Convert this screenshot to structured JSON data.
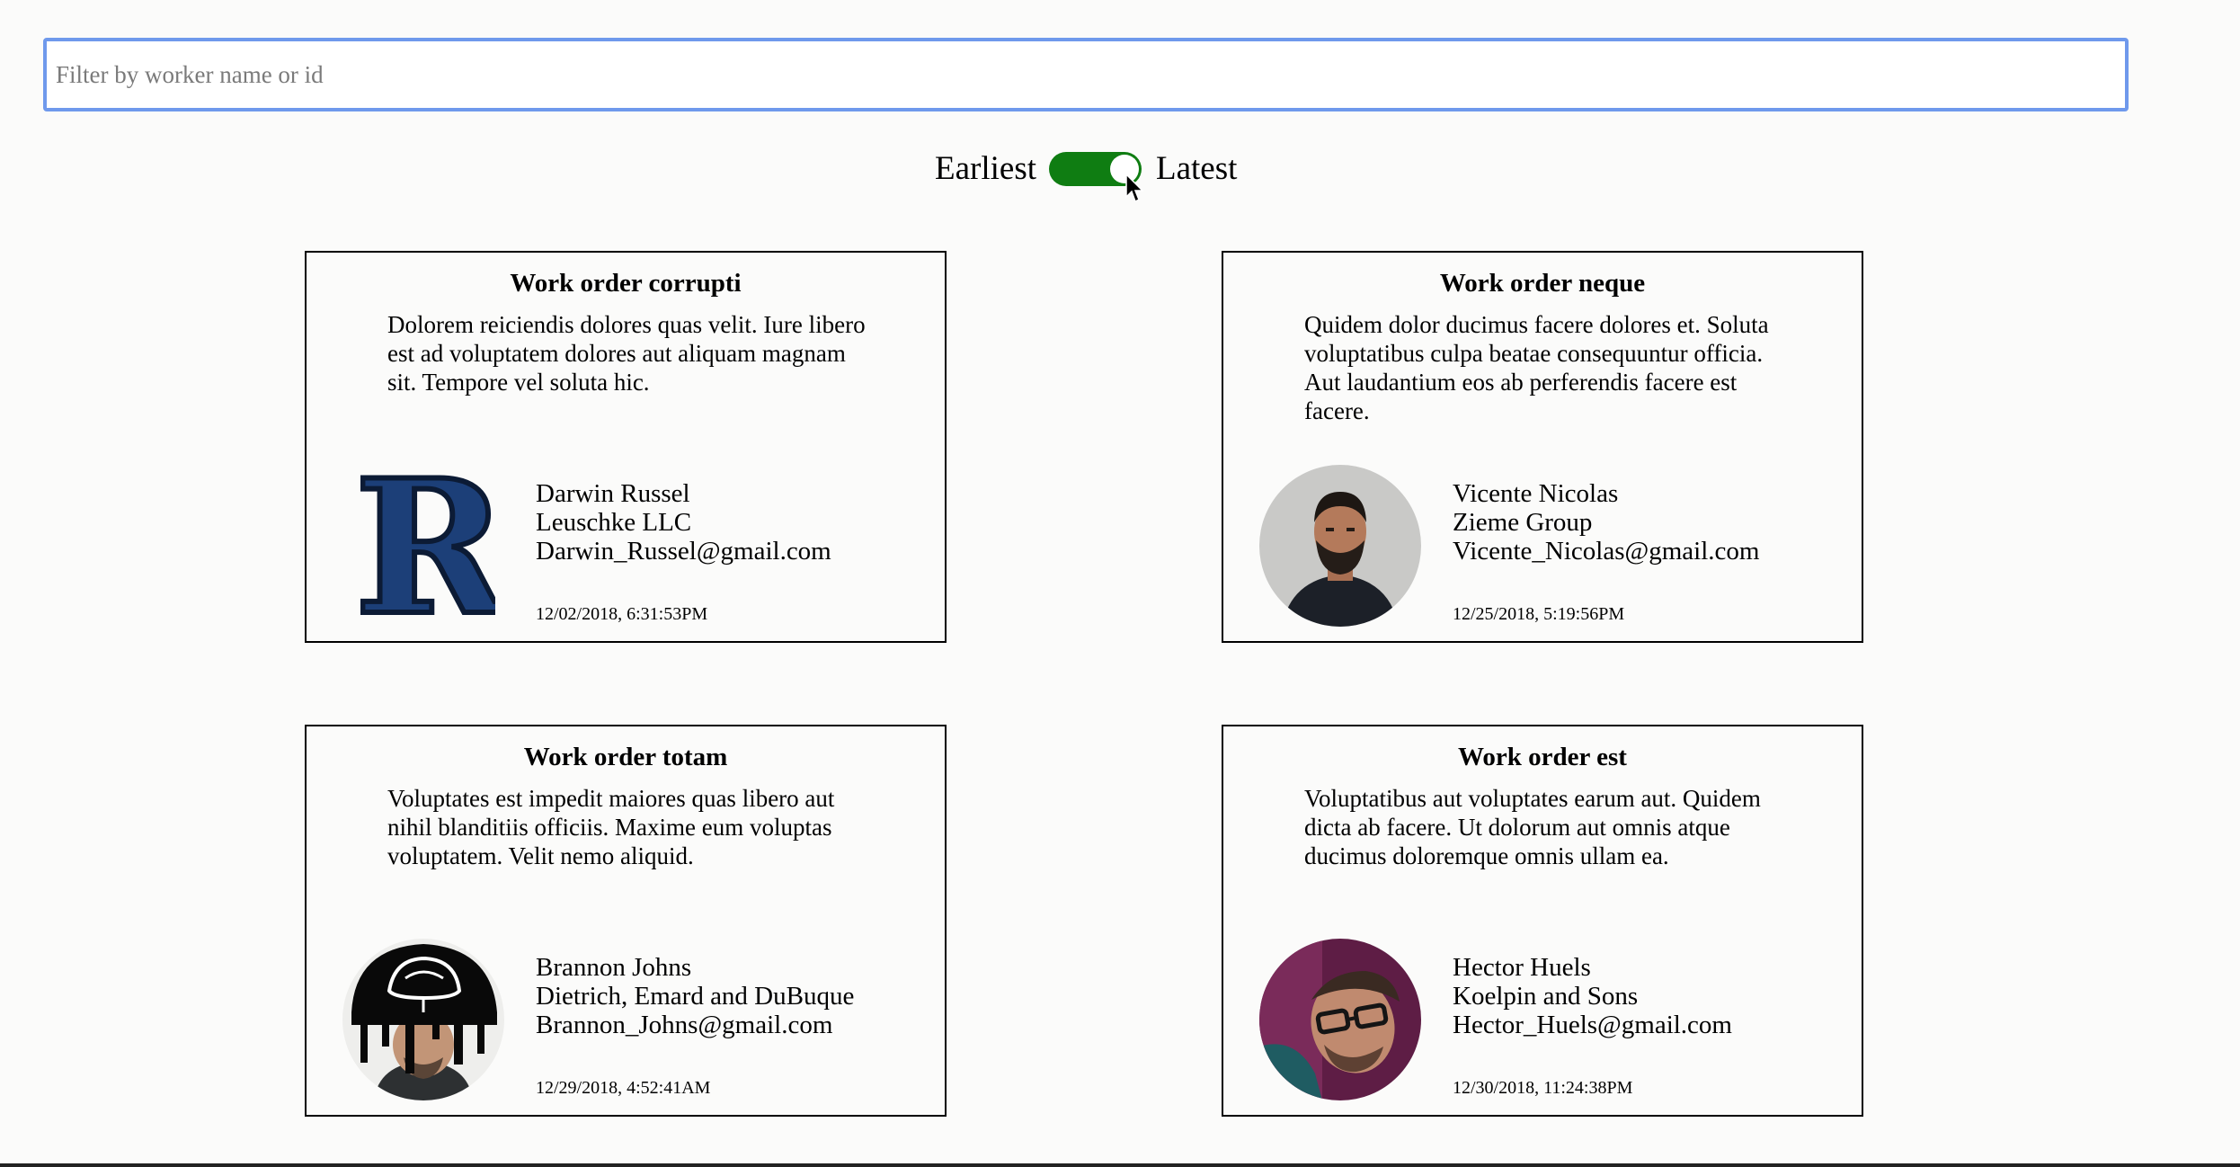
{
  "filter": {
    "placeholder": "Filter by worker name or id"
  },
  "sort_toggle": {
    "left_label": "Earliest",
    "right_label": "Latest",
    "state": "latest",
    "on_color": "#0f7d12"
  },
  "cards": [
    {
      "title": "Work order corrupti",
      "description": "Dolorem reiciendis dolores quas velit. Iure libero est ad voluptatem dolores aut aliquam magnam sit. Tempore vel soluta hic.",
      "worker": {
        "name": "Darwin Russel",
        "company": "Leuschke LLC",
        "email": "Darwin_Russel@gmail.com",
        "avatar": "blackletter-r-logo"
      },
      "deadline": "12/02/2018, 6:31:53PM"
    },
    {
      "title": "Work order neque",
      "description": "Quidem dolor ducimus facere dolores et. Soluta voluptatibus culpa beatae consequuntur officia. Aut laudantium eos ab perferendis facere est facere.",
      "worker": {
        "name": "Vicente Nicolas",
        "company": "Zieme Group",
        "email": "Vicente_Nicolas@gmail.com",
        "avatar": "bearded-man-photo"
      },
      "deadline": "12/25/2018, 5:19:56PM"
    },
    {
      "title": "Work order totam",
      "description": "Voluptates est impedit maiores quas libero aut nihil blanditiis officiis. Maxime eum voluptas voluptatem. Velit nemo aliquid.",
      "worker": {
        "name": "Brannon Johns",
        "company": "Dietrich, Emard and DuBuque",
        "email": "Brannon_Johns@gmail.com",
        "avatar": "dripping-art-photo"
      },
      "deadline": "12/29/2018, 4:52:41AM"
    },
    {
      "title": "Work order est",
      "description": "Voluptatibus aut voluptates earum aut. Quidem dicta ab facere. Ut dolorum aut omnis atque ducimus doloremque omnis ullam ea.",
      "worker": {
        "name": "Hector Huels",
        "company": "Koelpin and Sons",
        "email": "Hector_Huels@gmail.com",
        "avatar": "glasses-man-photo"
      },
      "deadline": "12/30/2018, 11:24:38PM"
    }
  ]
}
